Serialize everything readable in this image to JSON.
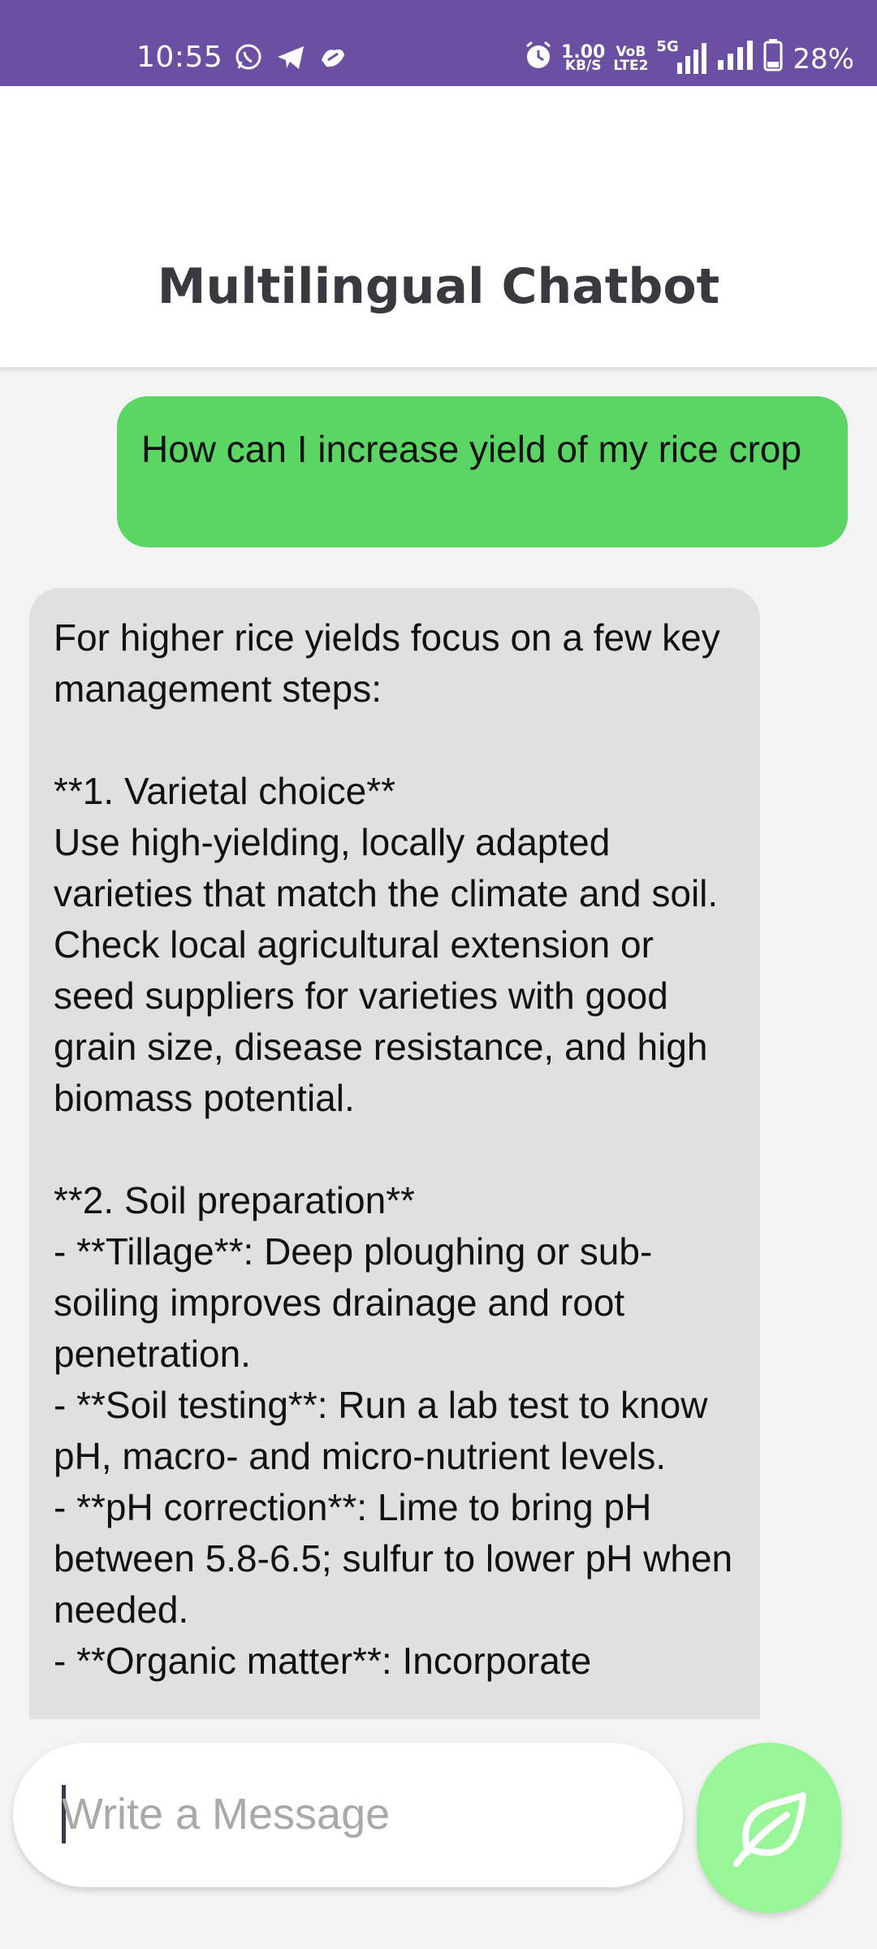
{
  "status_bar": {
    "time": "10:55",
    "net_speed_value": "1.00",
    "net_speed_unit": "KB/S",
    "volte_top": "VoB",
    "volte_bottom": "LTE2",
    "network": "5G",
    "battery": "28%"
  },
  "header": {
    "title": "Multilingual Chatbot"
  },
  "messages": {
    "user_1": "How can I increase yield of my rice crop",
    "bot_1": "For higher rice yields focus on a few key management steps:\n\n**1. Varietal choice**\nUse high-yielding, locally adapted varieties that match the climate and soil. Check local agricultural extension or seed suppliers for varieties with good grain size, disease resistance, and high biomass potential.\n\n**2. Soil preparation**\n- **Tillage**: Deep ploughing or sub-soiling improves drainage and root penetration.\n- **Soil testing**: Run a lab test to know pH, macro- and micro-nutrient levels.\n- **pH correction**: Lime to bring pH between 5.8-6.5; sulfur to lower pH when needed.\n- **Organic matter**: Incorporate"
  },
  "composer": {
    "placeholder": "Write a Message"
  },
  "colors": {
    "status_bar": "#6a4fa3",
    "user_bubble": "#5bd563",
    "bot_bubble": "#e0e0e0",
    "send_button": "#98f598"
  }
}
